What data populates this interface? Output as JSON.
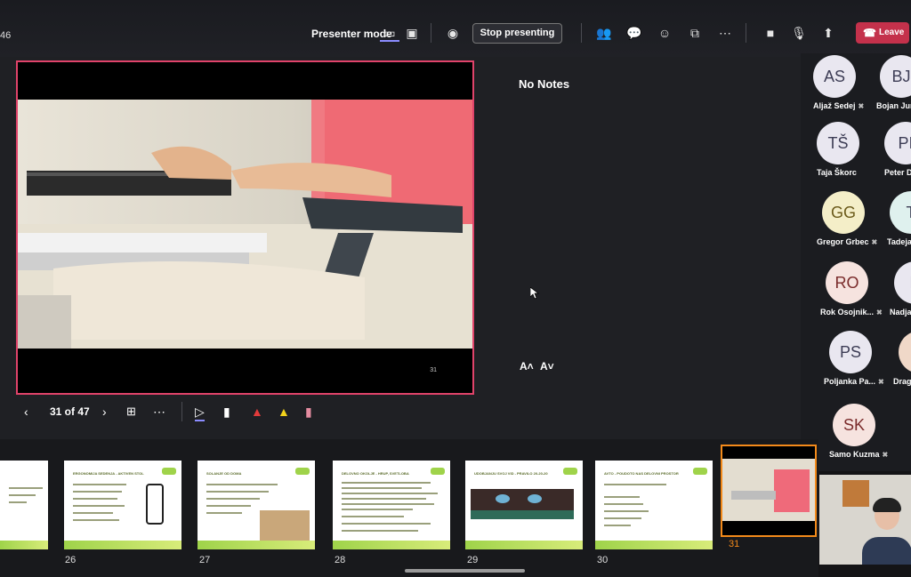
{
  "topbar": {
    "time": "46",
    "presenter_mode_label": "Presenter mode",
    "stop_presenting_label": "Stop presenting",
    "leave_label": "Leave"
  },
  "slide": {
    "number": "31",
    "notes_text": "No Notes",
    "font_increase": "A˄",
    "font_decrease": "A˅"
  },
  "navigation": {
    "counter": "31 of 47",
    "prev_icon": "chevron-left-icon",
    "next_icon": "chevron-right-icon"
  },
  "participants": [
    {
      "initials": "AS",
      "name": "Aljaž Sedej"
    },
    {
      "initials": "BJ",
      "name": "Bojan Jurc"
    },
    {
      "initials": "TŠ",
      "name": "Taja Škorc"
    },
    {
      "initials": "PI",
      "name": "Peter D"
    },
    {
      "initials": "GG",
      "name": "Gregor Grbec"
    },
    {
      "initials": "T",
      "name": "Tadeja"
    },
    {
      "initials": "RO",
      "name": "Rok Osojnik..."
    },
    {
      "initials": "N",
      "name": "Nadja"
    },
    {
      "initials": "PS",
      "name": "Poljanka Pa..."
    },
    {
      "initials": "",
      "name": "Drag"
    },
    {
      "initials": "SK",
      "name": "Samo Kuzma"
    }
  ],
  "thumbnails": [
    {
      "num": "",
      "title": "",
      "kind": "text"
    },
    {
      "num": "26",
      "title": "ERGONOMIJA SEDENJA - AKTIVEN STOL",
      "kind": "chair"
    },
    {
      "num": "27",
      "title": "SOLANJE OD DOMA",
      "kind": "photo"
    },
    {
      "num": "28",
      "title": "DELOVNO OKOLJE - HRUP, SVETLOBA",
      "kind": "text"
    },
    {
      "num": "29",
      "title": "UDOBJANJU SVOJ VID - PRAVILO 20-20-20",
      "kind": "eyes"
    },
    {
      "num": "30",
      "title": "AVTO - POUDOTO NAS DELOVNI PROSTOR",
      "kind": "text"
    },
    {
      "num": "31",
      "title": "",
      "kind": "current"
    }
  ],
  "colors": {
    "slide_border": "#e0436a",
    "leave_button": "#c4314b",
    "active_thumb": "#f38a1a",
    "accent": "#8b8cff"
  }
}
